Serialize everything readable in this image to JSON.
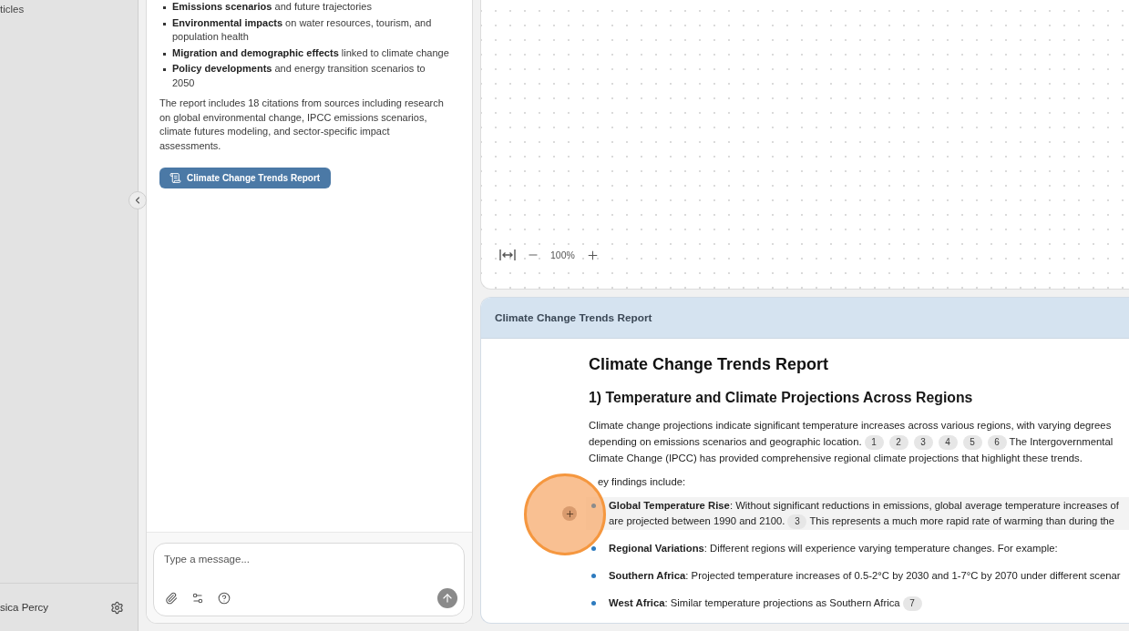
{
  "sidebar": {
    "items": [
      {
        "label": "ticles"
      }
    ],
    "user": {
      "name": "sica Percy"
    }
  },
  "chat": {
    "bullets": [
      "**Emissions scenarios** and future trajectories",
      "**Environmental impacts** on water resources, tourism, and population health",
      "**Migration and demographic effects** linked to climate change",
      "**Policy developments** and energy transition scenarios to 2050"
    ],
    "summary": "The report includes 18 citations from sources including research on global environmental change, IPCC emissions scenarios, climate futures modeling, and sector-specific impact assessments.",
    "report_button": {
      "label": "Climate Change Trends Report"
    },
    "composer": {
      "placeholder": "Type a message..."
    }
  },
  "canvas": {
    "zoom_level": "100%"
  },
  "report": {
    "header_title": "Climate Change Trends Report",
    "title": "Climate Change Trends Report",
    "section_heading": "1) Temperature and Climate Projections Across Regions",
    "intro": {
      "lines": [
        [
          {
            "kind": "text",
            "text": "Climate change projections indicate significant temperature increases across various regions, with varying degrees"
          }
        ],
        [
          {
            "kind": "text",
            "text": "depending on emissions scenarios and geographic location."
          },
          {
            "kind": "cite",
            "text": "1"
          },
          {
            "kind": "cite",
            "text": "2"
          },
          {
            "kind": "cite",
            "text": "3"
          },
          {
            "kind": "cite",
            "text": "4"
          },
          {
            "kind": "cite",
            "text": "5"
          },
          {
            "kind": "cite",
            "text": "6"
          },
          {
            "kind": "text",
            "text": "The Intergovernmental"
          }
        ],
        [
          {
            "kind": "text",
            "text": "Climate Change (IPCC) has provided comprehensive regional climate projections that highlight these trends."
          }
        ]
      ]
    },
    "findings_label": "ey findings include:",
    "findings": [
      {
        "highlighted": true,
        "lines": [
          [
            {
              "kind": "text",
              "text": "**Global Temperature Rise**: Without significant reductions in emissions, global average temperature increases of"
            }
          ],
          [
            {
              "kind": "text",
              "text": "are projected between 1990 and 2100."
            },
            {
              "kind": "cite",
              "text": "3"
            },
            {
              "kind": "text",
              "text": "This represents a much more rapid rate of warming than during the"
            }
          ]
        ]
      },
      {
        "highlighted": false,
        "lines": [
          [
            {
              "kind": "text",
              "text": "**Regional Variations**: Different regions will experience varying temperature changes. For example:"
            }
          ]
        ]
      },
      {
        "highlighted": false,
        "lines": [
          [
            {
              "kind": "text",
              "text": "**Southern Africa**: Projected temperature increases of 0.5-2°C by 2030 and 1-7°C by 2070 under different scenar"
            }
          ]
        ]
      },
      {
        "highlighted": false,
        "lines": [
          [
            {
              "kind": "text",
              "text": "**West Africa**: Similar temperature projections as Southern Africa"
            },
            {
              "kind": "cite",
              "text": "7"
            }
          ]
        ]
      }
    ]
  }
}
